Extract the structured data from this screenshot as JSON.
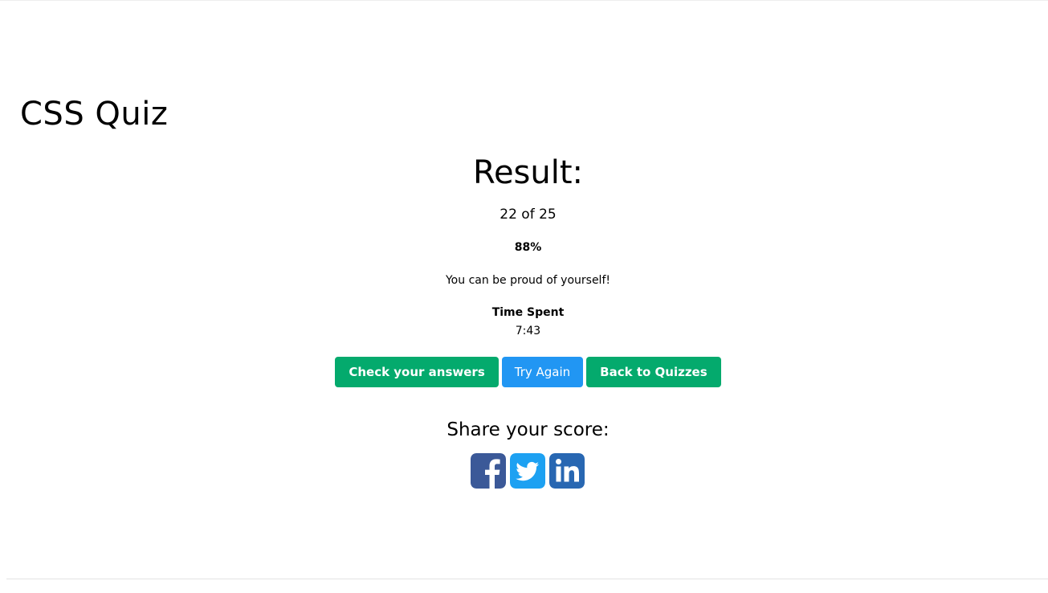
{
  "quiz": {
    "title": "CSS Quiz"
  },
  "result": {
    "heading": "Result:",
    "score_text": "22 of 25",
    "percent_text": "88%",
    "message": "You can be proud of yourself!",
    "time_label": "Time Spent",
    "time_value": "7:43"
  },
  "actions": {
    "check_answers_label": "Check your answers",
    "try_again_label": "Try Again",
    "back_label": "Back to Quizzes"
  },
  "share": {
    "heading": "Share your score:",
    "icons": [
      "facebook-icon",
      "twitter-icon",
      "linkedin-icon"
    ]
  },
  "colors": {
    "green": "#04aa6d",
    "blue": "#2196f3",
    "facebook": "#3b5998",
    "twitter": "#1da1f2",
    "linkedin": "#2867b2"
  }
}
